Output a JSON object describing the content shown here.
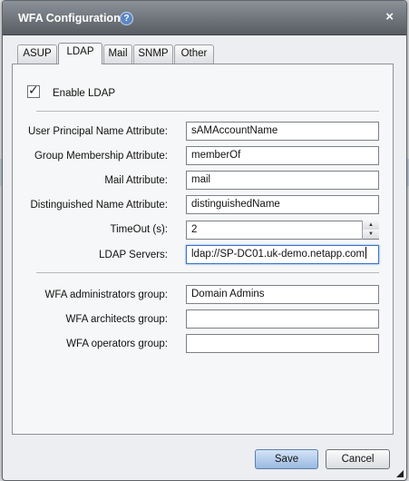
{
  "dialog": {
    "title": "WFA Configuration",
    "help": "?",
    "close": "×"
  },
  "tabs": [
    {
      "label": "ASUP",
      "active": false
    },
    {
      "label": "LDAP",
      "active": true
    },
    {
      "label": "Mail",
      "active": false
    },
    {
      "label": "SNMP",
      "active": false
    },
    {
      "label": "Other",
      "active": false
    }
  ],
  "ldap": {
    "enable_label": "Enable LDAP",
    "enabled": true,
    "upn_label": "User Principal Name Attribute:",
    "upn_value": "sAMAccountName",
    "group_label": "Group Membership Attribute:",
    "group_value": "memberOf",
    "mail_label": "Mail Attribute:",
    "mail_value": "mail",
    "dn_label": "Distinguished Name Attribute:",
    "dn_value": "distinguishedName",
    "timeout_label": "TimeOut (s):",
    "timeout_value": "2",
    "servers_label": "LDAP Servers:",
    "servers_value": "ldap://SP-DC01.uk-demo.netapp.com",
    "admins_label": "WFA administrators group:",
    "admins_value": "Domain Admins",
    "architects_label": "WFA architects  group:",
    "architects_value": "",
    "operators_label": "WFA operators  group:",
    "operators_value": ""
  },
  "footer": {
    "save": "Save",
    "cancel": "Cancel"
  },
  "colors": {
    "titlebar": "#6e737a",
    "save_button": "#b3cdea",
    "focus": "#3b72c4"
  }
}
